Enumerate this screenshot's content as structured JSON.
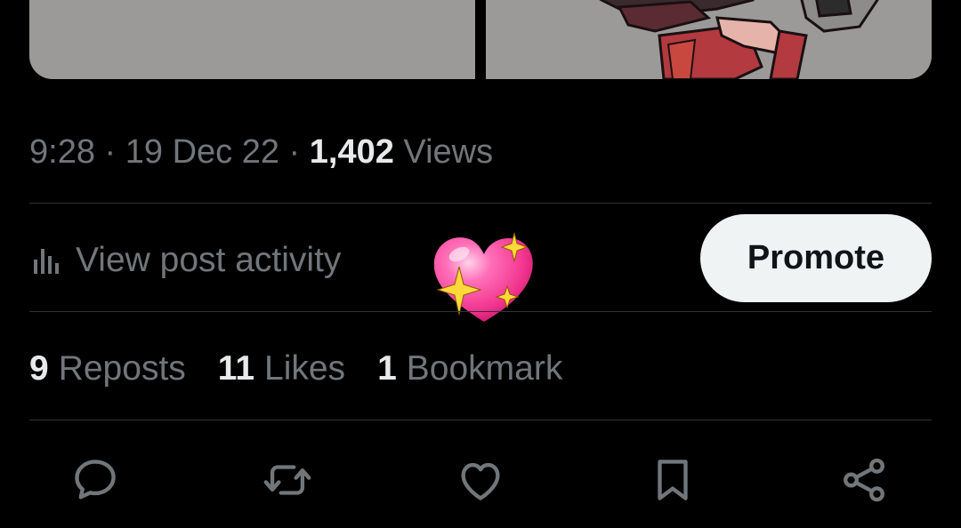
{
  "tweet": {
    "time": "9:28",
    "date": "19 Dec 22",
    "views_count": "1,402",
    "views_label": "Views",
    "separator": " · "
  },
  "activity": {
    "label": "View post activity",
    "icon": "analytics-bars-icon"
  },
  "promote_button": {
    "label": "Promote"
  },
  "sticker": {
    "icon": "sparkling-heart-icon"
  },
  "stats": [
    {
      "count": "9",
      "label": "Reposts"
    },
    {
      "count": "11",
      "label": "Likes"
    },
    {
      "count": "1",
      "label": "Bookmark"
    }
  ],
  "actions": [
    {
      "name": "reply",
      "icon": "reply-bubble-icon"
    },
    {
      "name": "repost",
      "icon": "repost-icon"
    },
    {
      "name": "like",
      "icon": "heart-outline-icon"
    },
    {
      "name": "bookmark",
      "icon": "bookmark-icon"
    },
    {
      "name": "share",
      "icon": "share-icon"
    }
  ],
  "colors": {
    "background": "#000000",
    "primary_text": "#e7e9ea",
    "secondary_text": "#71767b",
    "divider": "#2f3336",
    "promote_bg": "#eff3f4",
    "media_placeholder": "#9b9a98",
    "sticker_pink": "#f7479b"
  }
}
